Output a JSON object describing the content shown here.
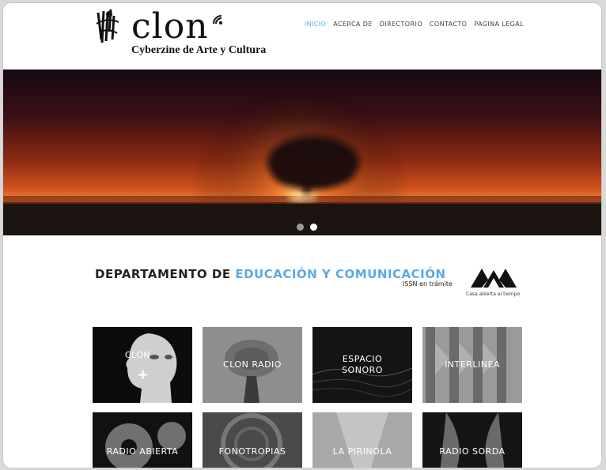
{
  "brand": {
    "logo_word": "clon",
    "tagline": "Cyberzine de Arte y Cultura"
  },
  "nav": {
    "items": [
      {
        "label": "INICIO",
        "active": true
      },
      {
        "label": "ACERCA DE",
        "active": false
      },
      {
        "label": "DIRECTORIO",
        "active": false
      },
      {
        "label": "CONTACTO",
        "active": false
      },
      {
        "label": "PAGINA LEGAL",
        "active": false
      }
    ]
  },
  "slider": {
    "total_slides": 2,
    "active_slide": 2
  },
  "department": {
    "prefix": "DEPARTAMENTO DE",
    "highlight": "EDUCACIÓN Y COMUNICACIÓN",
    "issn": "ISSN en trámite",
    "institution_motto": "Casa abierta al tiempo"
  },
  "tiles": [
    {
      "label": "CLON",
      "extra": "+"
    },
    {
      "label": "CLON RADIO"
    },
    {
      "label": "ESPACIO\nSONORO"
    },
    {
      "label": "INTERLINEA"
    },
    {
      "label": "RADIO ABIERTA"
    },
    {
      "label": "FONOTROPIAS"
    },
    {
      "label": "LA PIRINOLA"
    },
    {
      "label": "RADIO SORDA"
    }
  ],
  "colors": {
    "accent": "#5aa9e6",
    "text": "#222222"
  }
}
